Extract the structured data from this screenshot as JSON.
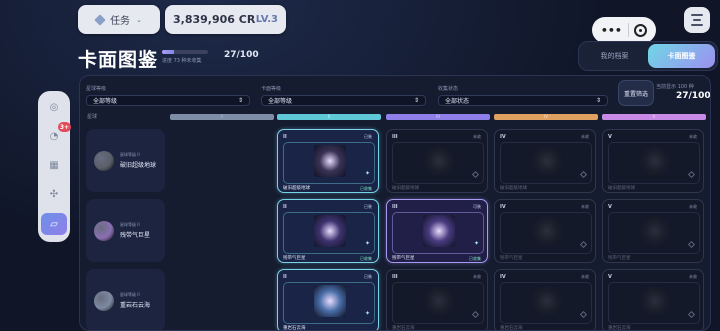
{
  "header": {
    "task_label": "任务",
    "credits": "3,839,906 CR",
    "level": "LV.3",
    "mini_more": "•••",
    "page_title": "卡面图鉴",
    "progress_fraction": 0.27,
    "progress_note": "进度 73 种未收集",
    "progress_count": "27/100"
  },
  "segments": {
    "archive": "我的档案",
    "gallery": "卡面图鉴"
  },
  "filters": {
    "planet_grade_label": "星球等级",
    "planet_grade_value": "全部等级",
    "card_grade_label": "卡面等级",
    "card_grade_value": "全部等级",
    "collect_label": "收集状态",
    "collect_value": "全部状态",
    "reset_label": "重置筛选",
    "display_label": "当前显示 100 种",
    "display_count": "27/100"
  },
  "table": {
    "planet_col": "星球",
    "grades": [
      "I",
      "II",
      "III",
      "IV",
      "V"
    ],
    "grade_colors": [
      "#7e8ea6",
      "#5fc9d8",
      "#8f7fe8",
      "#e0a060",
      "#c88ae6"
    ]
  },
  "rows": [
    {
      "planet_level": "星球等级 II",
      "planet_name": "破旧超级地球",
      "planet_color": "#5a5f6a",
      "cards": [
        null,
        {
          "rank": "II",
          "tag": "已装",
          "name": "破旧超级地球",
          "status": "已收集",
          "state": "owned",
          "art": "#3b3355"
        },
        {
          "rank": "III",
          "tag": "未收",
          "name": "破旧超级地球",
          "status": "",
          "state": "locked",
          "art": "#1d2230"
        },
        {
          "rank": "IV",
          "tag": "未收",
          "name": "破旧超级地球",
          "status": "",
          "state": "locked",
          "art": "#1d2230"
        },
        {
          "rank": "V",
          "tag": "未收",
          "name": "破旧超级地球",
          "status": "",
          "state": "locked",
          "art": "#1d2230"
        }
      ]
    },
    {
      "planet_level": "星球等级 II",
      "planet_name": "残带气巨星",
      "planet_color": "#8a6fb2",
      "cards": [
        null,
        {
          "rank": "II",
          "tag": "已装",
          "name": "残带气巨星",
          "status": "已收集",
          "state": "owned",
          "art": "#3f3470"
        },
        {
          "rank": "III",
          "tag": "可装",
          "name": "残带气巨星",
          "status": "已收集",
          "state": "owned-purple",
          "art": "#4a3b80"
        },
        {
          "rank": "IV",
          "tag": "未收",
          "name": "残带气巨星",
          "status": "",
          "state": "locked",
          "art": "#1d2230"
        },
        {
          "rank": "V",
          "tag": "未收",
          "name": "残带气巨星",
          "status": "",
          "state": "locked",
          "art": "#1d2230"
        }
      ]
    },
    {
      "planet_level": "星球等级 II",
      "planet_name": "重岩石云海",
      "planet_color": "#7d8aa2",
      "cards": [
        null,
        {
          "rank": "II",
          "tag": "已装",
          "name": "重岩石云海",
          "status": "",
          "state": "owned",
          "art": "#4a6ea8"
        },
        {
          "rank": "III",
          "tag": "未收",
          "name": "重岩石云海",
          "status": "",
          "state": "locked",
          "art": "#1d2230"
        },
        {
          "rank": "IV",
          "tag": "未收",
          "name": "重岩石云海",
          "status": "",
          "state": "locked",
          "art": "#1d2230"
        },
        {
          "rank": "V",
          "tag": "未收",
          "name": "重岩石云海",
          "status": "",
          "state": "locked",
          "art": "#1d2230"
        }
      ]
    }
  ],
  "rail": {
    "badge": "3+",
    "icons": [
      "orbit-icon",
      "gauge-icon",
      "grid-icon",
      "move-icon",
      "card-icon"
    ]
  }
}
